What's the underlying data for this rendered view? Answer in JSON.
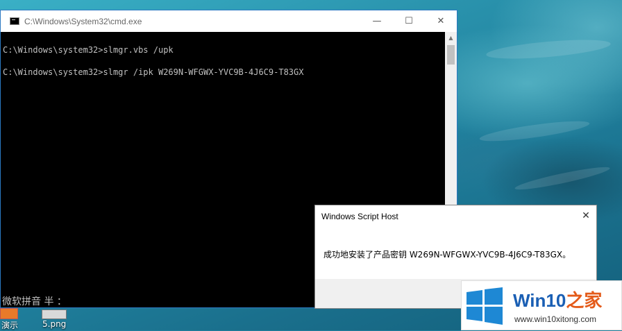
{
  "cmd_window": {
    "title": "C:\\Windows\\System32\\cmd.exe",
    "controls": {
      "minimize": "—",
      "maximize": "☐",
      "close": "✕"
    },
    "lines": [
      "C:\\Windows\\system32>slmgr.vbs /upk",
      "C:\\Windows\\system32>slmgr /ipk W269N-WFGWX-YVC9B-4J6C9-T83GX"
    ],
    "ime_status": "微软拼音 半 ："
  },
  "dialog": {
    "title": "Windows Script Host",
    "close": "✕",
    "message": "成功地安装了产品密钥 W269N-WFGWX-YVC9B-4J6C9-T83GX。"
  },
  "desktop": {
    "icons": [
      {
        "label": "演示"
      },
      {
        "label": "5.png"
      }
    ]
  },
  "watermark": {
    "brand_main": "Win10",
    "brand_accent": "之家",
    "url": "www.win10xitong.com",
    "colors": {
      "blue": "#1a5fb4",
      "orange": "#e45b1a"
    }
  }
}
